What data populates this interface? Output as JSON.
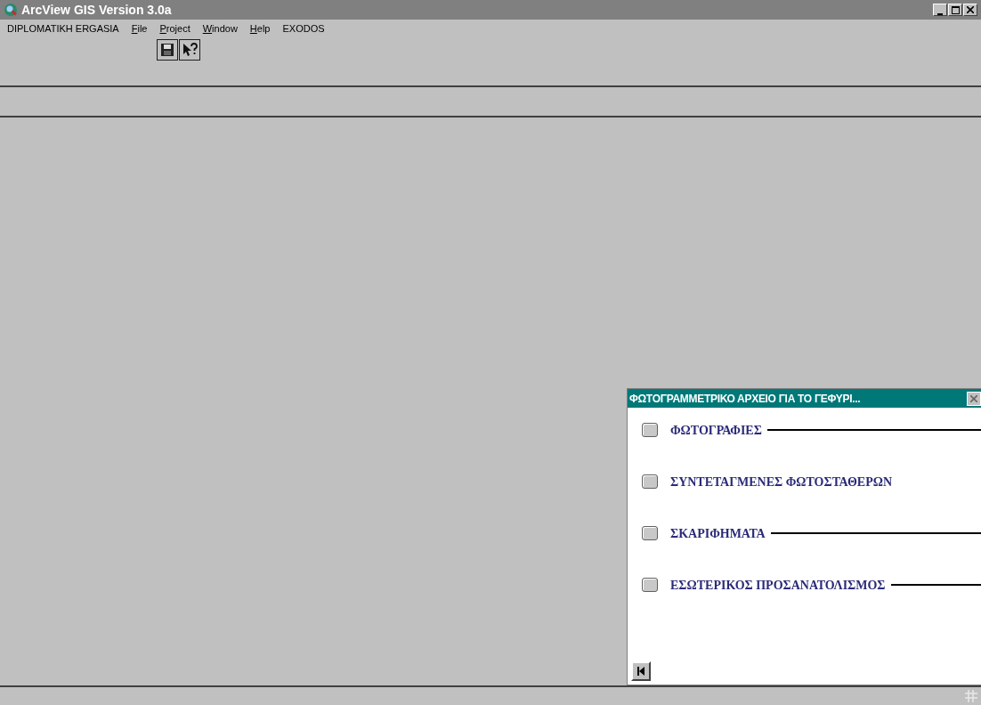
{
  "window": {
    "title": "ArcView GIS Version 3.0a"
  },
  "menu": [
    {
      "label": "DIPLOMATIKH ERGASIA",
      "mnemonic": false
    },
    {
      "label": "File",
      "mnemonic": true
    },
    {
      "label": "Project",
      "mnemonic": true
    },
    {
      "label": "Window",
      "mnemonic": true
    },
    {
      "label": "Help",
      "mnemonic": true
    },
    {
      "label": "EXODOS",
      "mnemonic": false
    }
  ],
  "toolbar": [
    {
      "kind": "save"
    },
    {
      "kind": "help"
    }
  ],
  "dialog": {
    "title": "ΦΩΤΟΓΡΑΜΜΕΤΡΙΚΟ ΑΡΧΕΙΟ ΓΙΑ ΤΟ ΓΕΦΥΡΙ...",
    "items": [
      {
        "label": "ΦΩΤΟΓΡΑΦΙΕΣ",
        "leader": true
      },
      {
        "label": "ΣΥΝΤΕΤΑΓΜΕΝΕΣ ΦΩΤΟΣΤΑΘΕΡΩΝ",
        "leader": false
      },
      {
        "label": "ΣΚΑΡΙΦΗΜΑΤΑ",
        "leader": true
      },
      {
        "label": "ΕΣΩΤΕΡΙΚΟΣ ΠΡΟΣΑΝΑΤΟΛΙΣΜΟΣ",
        "leader": true
      }
    ]
  }
}
